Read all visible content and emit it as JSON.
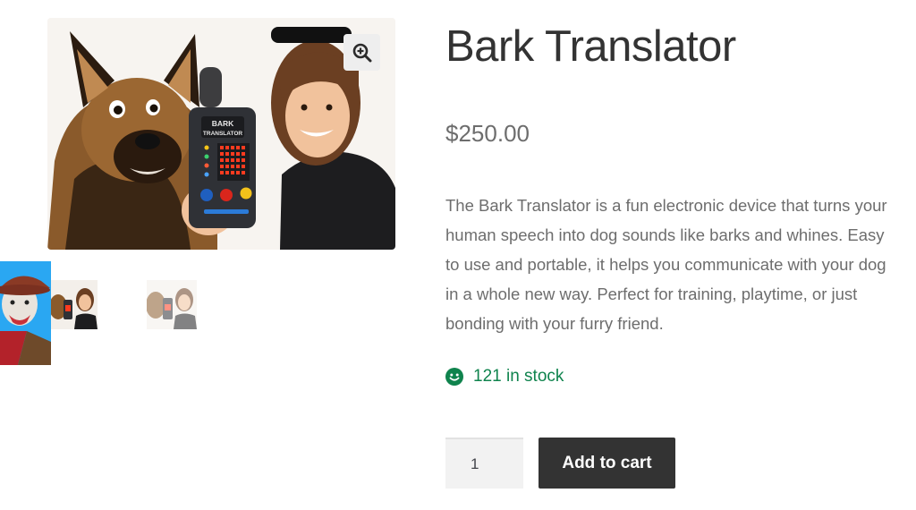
{
  "product": {
    "title": "Bark Translator",
    "price": "$250.00",
    "description": "The Bark Translator is a fun electronic device that turns your human speech into dog sounds like barks and whines. Easy to use and portable, it helps you communicate with your dog in a whole new way. Perfect for training, playtime, or just bonding with your furry friend.",
    "stock": "121 in stock",
    "device_label_line1": "BARK",
    "device_label_line2": "TRANSLATOR"
  },
  "cart": {
    "quantity": "1",
    "add_to_cart_label": "Add to cart"
  },
  "gallery": {
    "zoom_icon": "zoom-in-icon",
    "thumbnails": [
      "cowboy-dog-thumbnail",
      "dog-woman-translator-thumbnail",
      "dog-woman-translator-faded-thumbnail"
    ]
  },
  "colors": {
    "stock_green": "#0f834d",
    "button_dark": "#333333",
    "thumb_sky": "#2aa7f2"
  }
}
